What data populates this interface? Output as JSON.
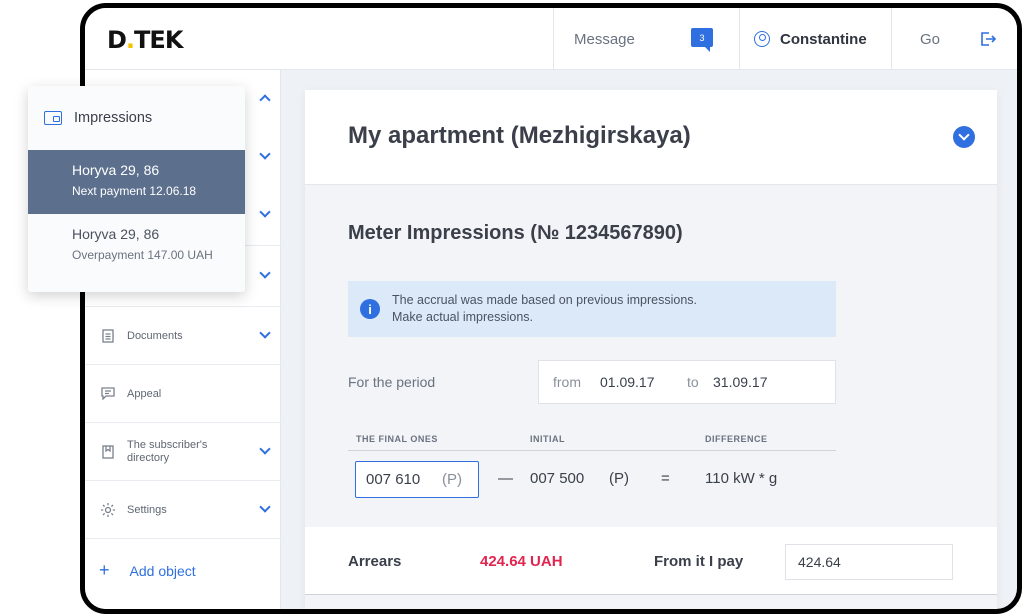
{
  "brand": {
    "logo_main": "D",
    "logo_rest": "TEK"
  },
  "header": {
    "message_label": "Message",
    "message_count": "3",
    "user_name": "Constantine",
    "go_label": "Go"
  },
  "sidebar": {
    "items": [
      {
        "label": "Documents",
        "icon": "document-icon"
      },
      {
        "label": "Appeal",
        "icon": "chat-icon"
      },
      {
        "label": "The subscriber's directory",
        "icon": "directory-icon"
      },
      {
        "label": "Settings",
        "icon": "gear-icon"
      }
    ],
    "add_object": "Add object"
  },
  "popup": {
    "title": "Impressions",
    "items": [
      {
        "name": "Horyva 29, 86",
        "sub": "Next payment 12.06.18",
        "active": true
      },
      {
        "name": "Horyva 29, 86",
        "sub": "Overpayment 147.00 UAH",
        "active": false
      }
    ]
  },
  "main": {
    "title": "My apartment (Mezhigirskaya)",
    "section_title": "Meter Impressions (№ 1234567890)",
    "notice_line1": "The accrual was made based on previous impressions.",
    "notice_line2": "Make actual impressions.",
    "period_label": "For the period",
    "period_from_label": "from",
    "period_from": "01.09.17",
    "period_to_label": "to",
    "period_to": "31.09.17",
    "columns": {
      "final": "THE FINAL ONES",
      "initial": "INITIAL",
      "difference": "DIFFERENCE"
    },
    "final_value": "007 610",
    "final_unit": "(P)",
    "minus": "—",
    "initial_value": "007 500",
    "initial_unit": "(P)",
    "equals": "=",
    "difference_value": "110 kW * g",
    "arrears_label": "Arrears",
    "arrears_amount": "424.64 UAH",
    "pay_label": "From it I pay",
    "pay_value": "424.64"
  },
  "colors": {
    "accent": "#2f6fe0",
    "arrears": "#e2254f",
    "active_item": "#5c6f8d"
  }
}
